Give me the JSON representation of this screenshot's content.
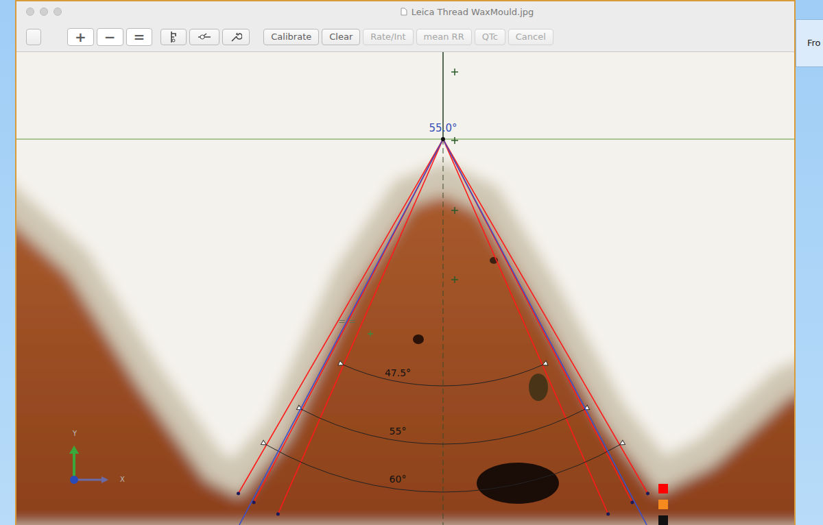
{
  "window": {
    "title": "Leica Thread WaxMould.jpg"
  },
  "toolbar": {
    "zoom_buttons": [
      "+",
      "−",
      "="
    ],
    "text_buttons": [
      {
        "label": "Calibrate",
        "disabled": false
      },
      {
        "label": "Clear",
        "disabled": false
      },
      {
        "label": "Rate/Int",
        "disabled": true
      },
      {
        "label": "mean RR",
        "disabled": true
      },
      {
        "label": "QTc",
        "disabled": true
      },
      {
        "label": "Cancel",
        "disabled": true
      }
    ]
  },
  "side_panel": {
    "label": "Fro"
  },
  "measurement": {
    "angle": "55.0°"
  },
  "guides": [
    {
      "label": "47.5°"
    },
    {
      "label": "55°"
    },
    {
      "label": "60°"
    }
  ],
  "marks": "= =",
  "axes": {
    "y": "Y",
    "x": "X"
  },
  "swatches": [
    {
      "color": "#ff0000"
    },
    {
      "color": "#f58a1f"
    },
    {
      "color": "#111111"
    }
  ]
}
